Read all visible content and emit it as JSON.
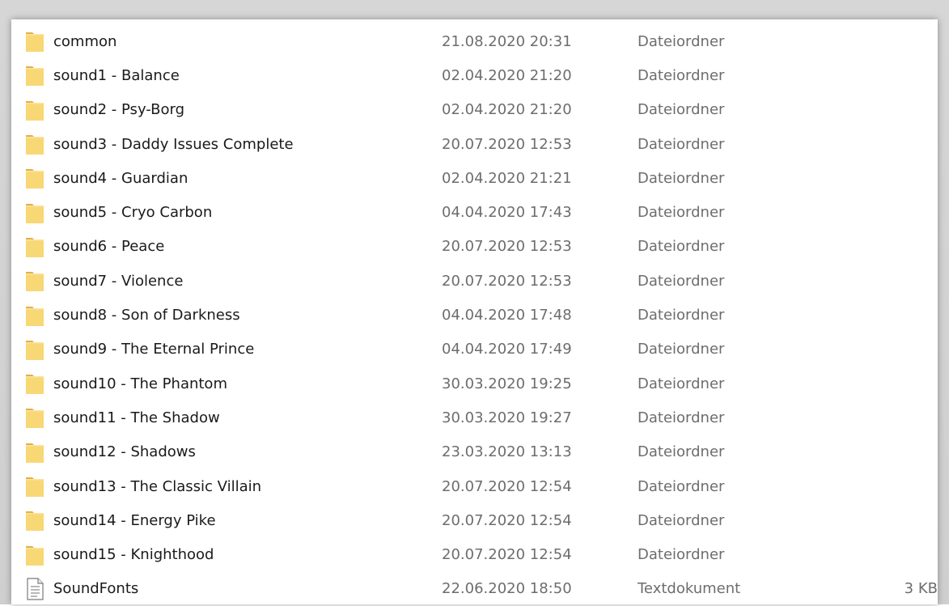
{
  "files": [
    {
      "name": "common",
      "date": "21.08.2020 20:31",
      "type": "Dateiordner",
      "size": "",
      "icon": "folder-icon"
    },
    {
      "name": "sound1 - Balance",
      "date": "02.04.2020 21:20",
      "type": "Dateiordner",
      "size": "",
      "icon": "folder-icon"
    },
    {
      "name": "sound2 - Psy-Borg",
      "date": "02.04.2020 21:20",
      "type": "Dateiordner",
      "size": "",
      "icon": "folder-icon"
    },
    {
      "name": "sound3 - Daddy Issues Complete",
      "date": "20.07.2020 12:53",
      "type": "Dateiordner",
      "size": "",
      "icon": "folder-icon"
    },
    {
      "name": "sound4 - Guardian",
      "date": "02.04.2020 21:21",
      "type": "Dateiordner",
      "size": "",
      "icon": "folder-icon"
    },
    {
      "name": "sound5 - Cryo Carbon",
      "date": "04.04.2020 17:43",
      "type": "Dateiordner",
      "size": "",
      "icon": "folder-icon"
    },
    {
      "name": "sound6 - Peace",
      "date": "20.07.2020 12:53",
      "type": "Dateiordner",
      "size": "",
      "icon": "folder-icon"
    },
    {
      "name": "sound7 - Violence",
      "date": "20.07.2020 12:53",
      "type": "Dateiordner",
      "size": "",
      "icon": "folder-icon"
    },
    {
      "name": "sound8 - Son of Darkness",
      "date": "04.04.2020 17:48",
      "type": "Dateiordner",
      "size": "",
      "icon": "folder-icon"
    },
    {
      "name": "sound9 - The Eternal Prince",
      "date": "04.04.2020 17:49",
      "type": "Dateiordner",
      "size": "",
      "icon": "folder-icon"
    },
    {
      "name": "sound10 - The Phantom",
      "date": "30.03.2020 19:25",
      "type": "Dateiordner",
      "size": "",
      "icon": "folder-icon"
    },
    {
      "name": "sound11 - The Shadow",
      "date": "30.03.2020 19:27",
      "type": "Dateiordner",
      "size": "",
      "icon": "folder-icon"
    },
    {
      "name": "sound12 - Shadows",
      "date": "23.03.2020 13:13",
      "type": "Dateiordner",
      "size": "",
      "icon": "folder-icon"
    },
    {
      "name": "sound13 - The Classic Villain",
      "date": "20.07.2020 12:54",
      "type": "Dateiordner",
      "size": "",
      "icon": "folder-icon"
    },
    {
      "name": "sound14 - Energy Pike",
      "date": "20.07.2020 12:54",
      "type": "Dateiordner",
      "size": "",
      "icon": "folder-icon"
    },
    {
      "name": "sound15 - Knighthood",
      "date": "20.07.2020 12:54",
      "type": "Dateiordner",
      "size": "",
      "icon": "folder-icon"
    },
    {
      "name": "SoundFonts",
      "date": "22.06.2020 18:50",
      "type": "Textdokument",
      "size": "3 KB",
      "icon": "text-document-icon"
    }
  ],
  "colors": {
    "folder_fill": "#f8d775",
    "folder_back": "#e8b94a",
    "secondary_text": "#6d6d6d"
  }
}
